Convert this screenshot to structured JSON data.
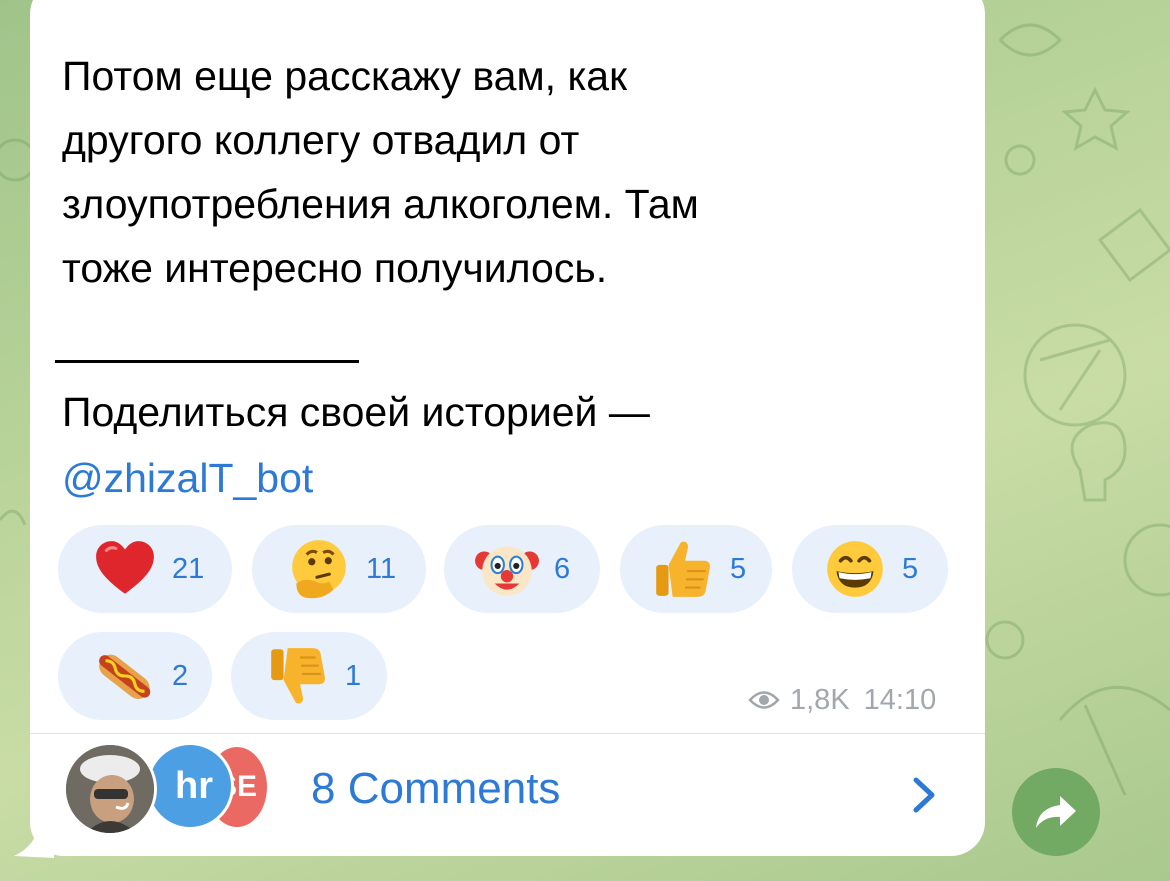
{
  "message": {
    "text": "Потом еще расскажу вам, как\nдругого коллегу отвадил от\nзлоупотребления алкоголем. Там\nтоже интересно получилось.",
    "share_prompt": "Поделиться своей историей —",
    "bot_link": "@zhizalT_bot"
  },
  "reactions": [
    {
      "emoji": "red-heart",
      "count": "21"
    },
    {
      "emoji": "thinking-face",
      "count": "11"
    },
    {
      "emoji": "clown-face",
      "count": "6"
    },
    {
      "emoji": "thumbs-up",
      "count": "5"
    },
    {
      "emoji": "grinning-face",
      "count": "5"
    },
    {
      "emoji": "hot-dog",
      "count": "2"
    },
    {
      "emoji": "thumbs-down",
      "count": "1"
    }
  ],
  "meta": {
    "views": "1,8K",
    "time": "14:10"
  },
  "comments": {
    "label": "8 Comments",
    "avatars": [
      {
        "name": "photo-avatar"
      },
      {
        "name": "hr-avatar",
        "initials": "hr",
        "color": "#4d9fe4"
      },
      {
        "name": "se-avatar",
        "initials": "SE",
        "color": "#ea6a63"
      }
    ]
  },
  "colors": {
    "link": "#2d7ad6",
    "reaction_bg": "#e7f0fb",
    "share_button": "#72a963",
    "meta": "#a2a7ad"
  }
}
